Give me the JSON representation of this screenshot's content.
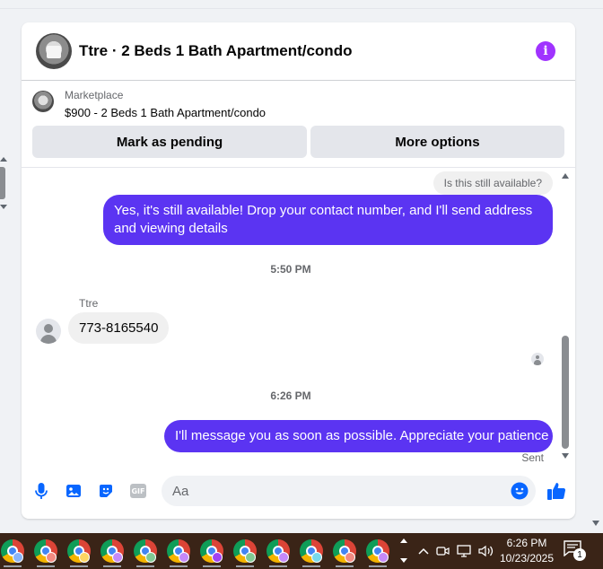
{
  "conversation": {
    "title": "Ttre · 2 Beds 1 Bath Apartment/condo",
    "listing_source": "Marketplace",
    "listing_item": "$900 - 2 Beds 1 Bath Apartment/condo",
    "actions": {
      "mark_pending": "Mark as pending",
      "more_options": "More options"
    }
  },
  "messages": {
    "incoming_question": "Is this still available?",
    "outgoing_1": "Yes, it's still available! Drop your contact number, and I'll send address and viewing details",
    "time_1": "5:50 PM",
    "sender_name": "Ttre",
    "incoming_reply": "773-8165540",
    "time_2": "6:26 PM",
    "outgoing_2": "I'll message you as soon as possible. Appreciate your patience",
    "status": "Sent"
  },
  "composer": {
    "placeholder": "Aa"
  },
  "taskbar": {
    "time": "6:26 PM",
    "date": "10/23/2025",
    "notification_count": "1",
    "app_profile_colors": [
      "#8ab4f8",
      "#f28b82",
      "#fdd663",
      "#c58af9",
      "#81c995",
      "#c58af9",
      "#a142f4",
      "#81c995",
      "#c58af9",
      "#78d9ec",
      "#f28b82",
      "#c58af9"
    ]
  },
  "colors": {
    "accent": "#5b34f2",
    "info": "#a033ff",
    "messenger_blue": "#0866ff"
  }
}
